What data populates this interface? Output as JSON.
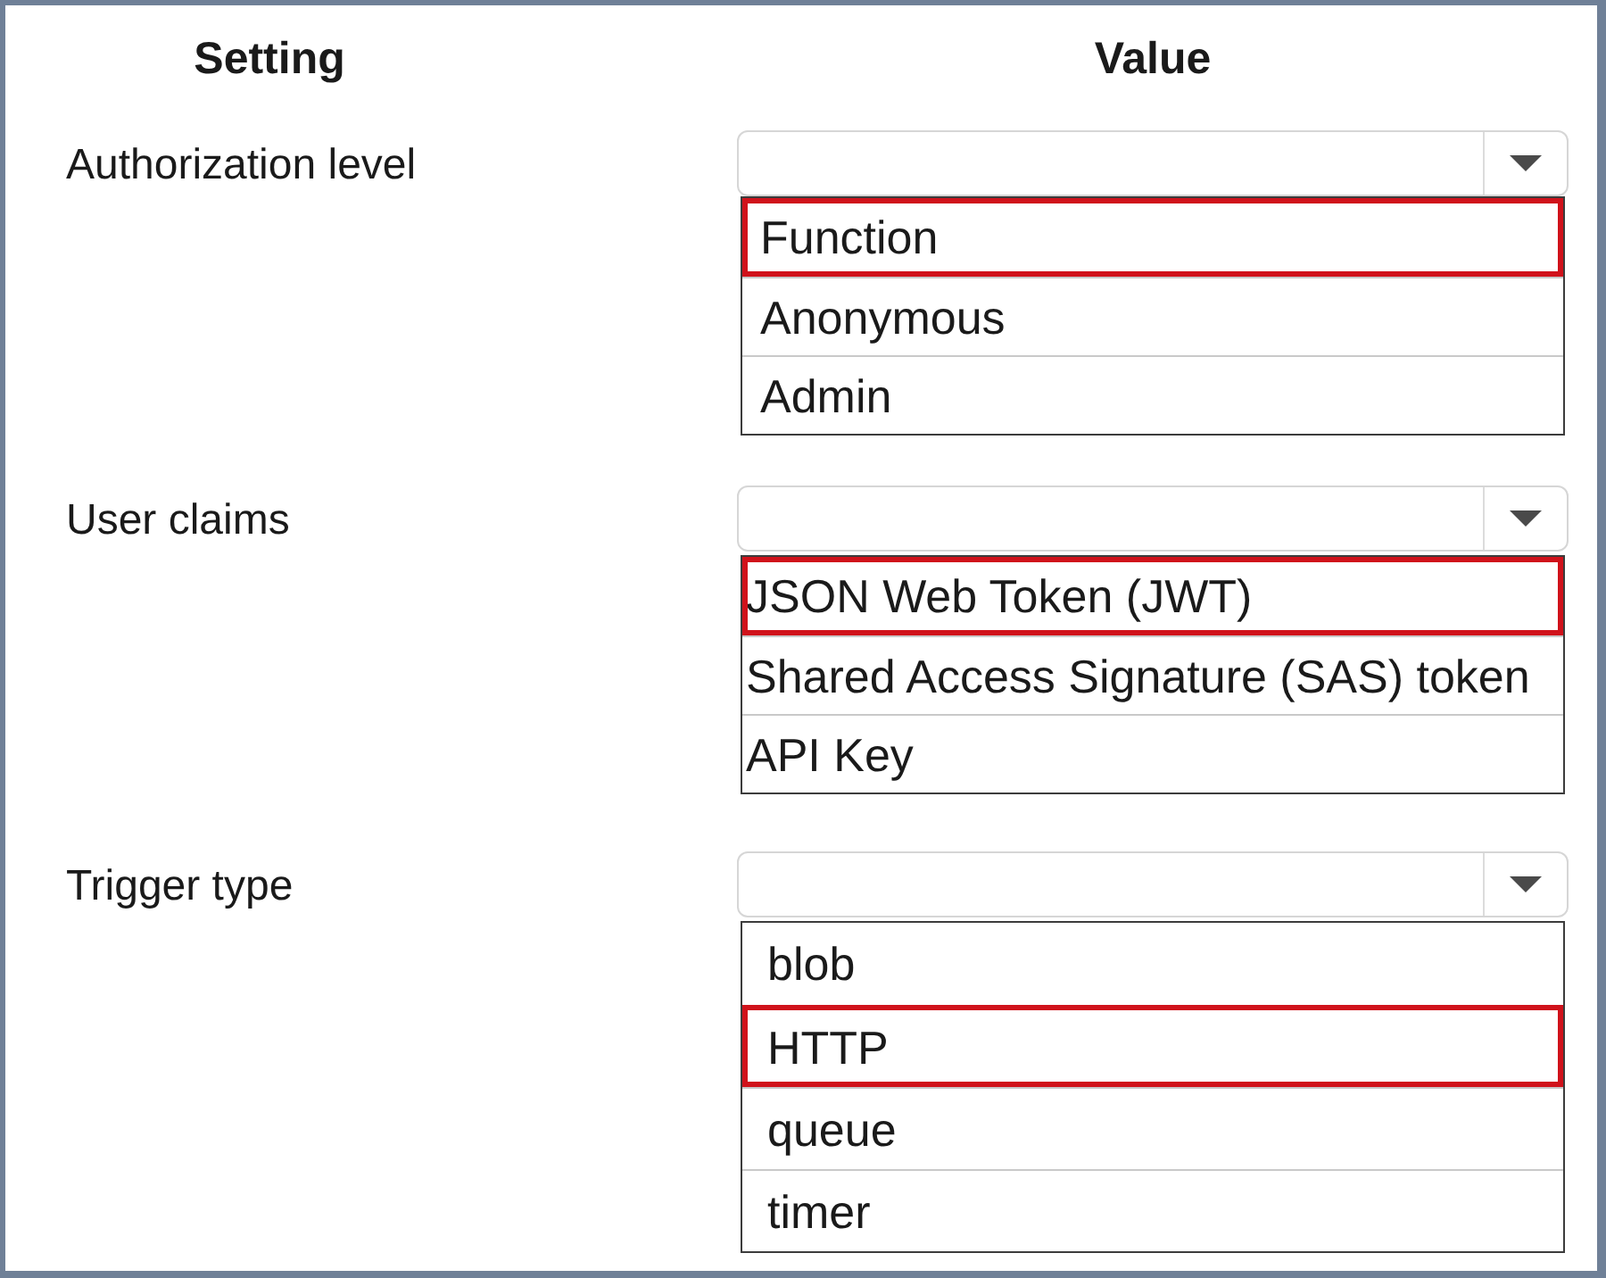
{
  "headers": {
    "setting": "Setting",
    "value": "Value"
  },
  "settings": [
    {
      "label": "Authorization level",
      "options": [
        {
          "label": "Function",
          "selected": true
        },
        {
          "label": "Anonymous",
          "selected": false
        },
        {
          "label": "Admin",
          "selected": false
        }
      ]
    },
    {
      "label": "User claims",
      "options": [
        {
          "label": "JSON Web Token (JWT)",
          "selected": true
        },
        {
          "label": "Shared Access Signature (SAS) token",
          "selected": false
        },
        {
          "label": "API Key",
          "selected": false
        }
      ]
    },
    {
      "label": "Trigger type",
      "options": [
        {
          "label": "blob",
          "selected": false
        },
        {
          "label": "HTTP",
          "selected": true
        },
        {
          "label": "queue",
          "selected": false
        },
        {
          "label": "timer",
          "selected": false
        }
      ]
    }
  ]
}
